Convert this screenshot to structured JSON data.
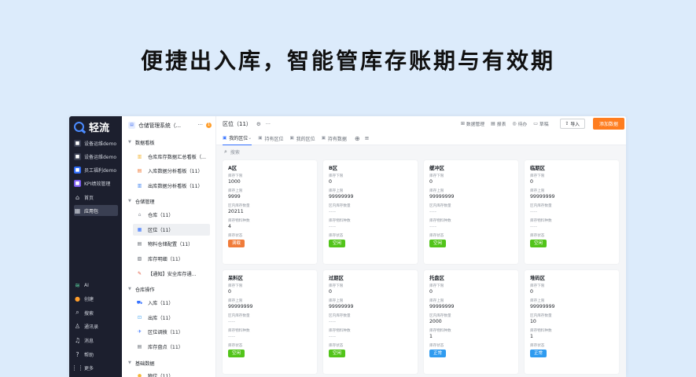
{
  "headline": "便捷出入库，智能管库存账期与有效期",
  "nav": {
    "logo": "轻流",
    "items": [
      {
        "label": "设备运维demo",
        "color": "#3a3f52"
      },
      {
        "label": "设备运维demo",
        "color": "#3a3f52"
      },
      {
        "label": "员工福利demo",
        "color": "#2f6cf6"
      },
      {
        "label": "KPI绩效管理",
        "color": "#7b5cf0"
      },
      {
        "label": "首页",
        "icon": "⌂"
      },
      {
        "label": "应用包",
        "icon": "▦"
      }
    ],
    "bottom": [
      {
        "label": "AI",
        "icon": "≋"
      },
      {
        "label": "创建",
        "icon": "●"
      },
      {
        "label": "搜索",
        "icon": "⌕"
      },
      {
        "label": "通讯录",
        "icon": "♙"
      },
      {
        "label": "消息",
        "icon": "♫"
      },
      {
        "label": "帮助",
        "icon": "?"
      },
      {
        "label": "更多",
        "icon": "⋮⋮"
      }
    ]
  },
  "tree": {
    "title": "仓储管理系统（...",
    "more": "···",
    "badge": "1",
    "groups": [
      {
        "label": "数据看板"
      },
      {
        "label": "仓储管理"
      },
      {
        "label": "仓库操作"
      },
      {
        "label": "基础数据"
      }
    ],
    "leaves": [
      {
        "label": "仓库库存数据汇总看板（...",
        "icon_color": "#f3b73a",
        "icon": "▥"
      },
      {
        "label": "入库数据分析看板（11）",
        "icon_color": "#f07c3a",
        "icon": "▤"
      },
      {
        "label": "出库数据分析看板（11）",
        "icon_color": "#4a8af0",
        "icon": "▥"
      },
      {
        "label": "仓库（11）",
        "icon_color": "#8f959e",
        "icon": "⌂"
      },
      {
        "label": "区位（11）",
        "icon_color": "#3370ff",
        "icon": "▦"
      },
      {
        "label": "物料仓储配置（11）",
        "icon_color": "#646a73",
        "icon": "▤"
      },
      {
        "label": "库存明细（11）",
        "icon_color": "#646a73",
        "icon": "▧"
      },
      {
        "label": "【通知】安全库存通...",
        "icon_color": "#e0533a",
        "icon": "✎"
      },
      {
        "label": "入库（11）",
        "icon_color": "#3370ff",
        "icon": "⛟"
      },
      {
        "label": "出库（11）",
        "icon_color": "#3aa0f0",
        "icon": "⊡"
      },
      {
        "label": "区位调拨（11）",
        "icon_color": "#3370ff",
        "icon": "✈"
      },
      {
        "label": "库存盘点（11）",
        "icon_color": "#646a73",
        "icon": "▤"
      },
      {
        "label": "物位（11）",
        "icon_color": "#f3b73a",
        "icon": "●"
      }
    ]
  },
  "main": {
    "title": "区位（11）",
    "toolbar": [
      {
        "icon": "⊞",
        "label": "数据管理"
      },
      {
        "icon": "▤",
        "label": "报表"
      },
      {
        "icon": "◎",
        "label": "待办"
      },
      {
        "icon": "▭",
        "label": "草稿"
      }
    ],
    "import_label": "导入",
    "add_label": "添加数据",
    "tabs": [
      {
        "label": "我的区位",
        "active": true
      },
      {
        "label": "持有区位"
      },
      {
        "label": "我的区位"
      },
      {
        "label": "持有数据"
      }
    ],
    "search_placeholder": "搜索",
    "field_labels": [
      "库存下限",
      "库存上限",
      "区内库存数量",
      "库存物料种数",
      "库存状态"
    ],
    "cards": [
      {
        "title": "A区",
        "values": [
          "1000",
          "9999",
          "20211",
          "4"
        ],
        "status": "满载",
        "status_color": "#f07c3a"
      },
      {
        "title": "B区",
        "values": [
          "0",
          "99999999",
          "----",
          "----"
        ],
        "status": "空闲",
        "status_color": "#52c41a"
      },
      {
        "title": "缓冲区",
        "values": [
          "0",
          "99999999",
          "----",
          "----"
        ],
        "status": "空闲",
        "status_color": "#52c41a"
      },
      {
        "title": "临期区",
        "values": [
          "0",
          "99999999",
          "----",
          "----"
        ],
        "status": "空闲",
        "status_color": "#52c41a"
      },
      {
        "title": "呆料区",
        "values": [
          "0",
          "99999999",
          "----",
          "----"
        ],
        "status": "空闲",
        "status_color": "#52c41a"
      },
      {
        "title": "过期区",
        "values": [
          "0",
          "99999999",
          "----",
          "----"
        ],
        "status": "空闲",
        "status_color": "#52c41a"
      },
      {
        "title": "托盘区",
        "values": [
          "0",
          "99999999",
          "2000",
          "1"
        ],
        "status": "正常",
        "status_color": "#2f9bf0"
      },
      {
        "title": "堆码区",
        "values": [
          "0",
          "99999999",
          "10",
          "1"
        ],
        "status": "正常",
        "status_color": "#2f9bf0"
      }
    ]
  }
}
